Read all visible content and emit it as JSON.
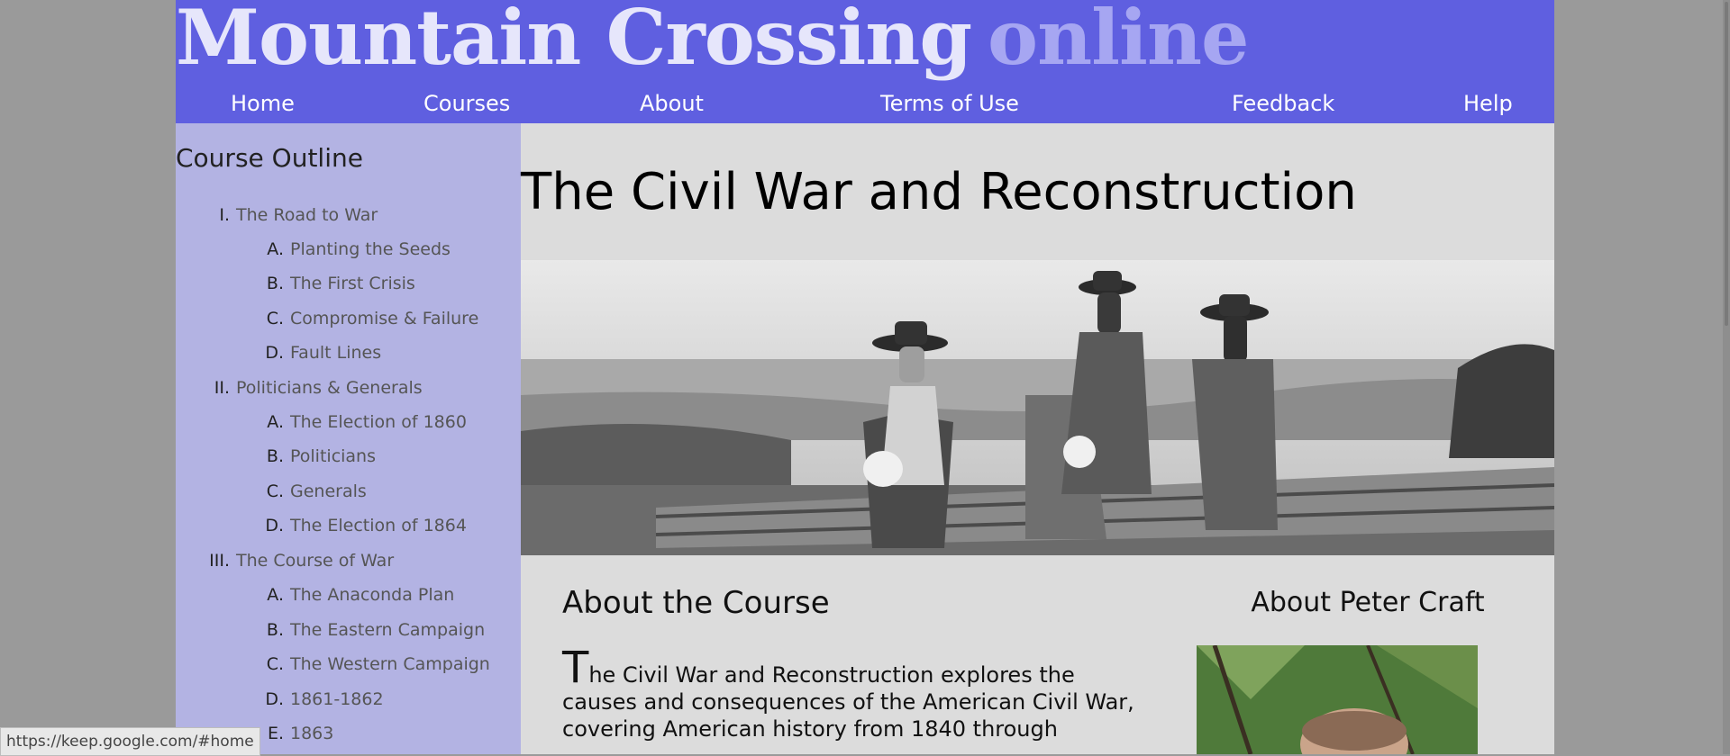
{
  "header": {
    "logo_main": "Mountain Crossing",
    "logo_sub": "online",
    "nav": [
      "Home",
      "Courses",
      "About",
      "Terms of Use",
      "Feedback",
      "Help"
    ]
  },
  "sidebar": {
    "title": "Course Outline",
    "outline": [
      {
        "num": "I.",
        "label": "The Road to War",
        "level": 1
      },
      {
        "num": "A.",
        "label": "Planting the Seeds",
        "level": 2
      },
      {
        "num": "B.",
        "label": "The First Crisis",
        "level": 2
      },
      {
        "num": "C.",
        "label": "Compromise & Failure",
        "level": 2
      },
      {
        "num": "D.",
        "label": "Fault Lines",
        "level": 2
      },
      {
        "num": "II.",
        "label": "Politicians & Generals",
        "level": 1
      },
      {
        "num": "A.",
        "label": "The Election of 1860",
        "level": 2
      },
      {
        "num": "B.",
        "label": "Politicians",
        "level": 2
      },
      {
        "num": "C.",
        "label": "Generals",
        "level": 2
      },
      {
        "num": "D.",
        "label": "The Election of 1864",
        "level": 2
      },
      {
        "num": "III.",
        "label": "The Course of War",
        "level": 1
      },
      {
        "num": "A.",
        "label": "The Anaconda Plan",
        "level": 2
      },
      {
        "num": "B.",
        "label": "The Eastern Campaign",
        "level": 2
      },
      {
        "num": "C.",
        "label": "The Western Campaign",
        "level": 2
      },
      {
        "num": "D.",
        "label": "1861-1862",
        "level": 2
      },
      {
        "num": "E.",
        "label": "1863",
        "level": 2
      }
    ]
  },
  "main": {
    "title": "The Civil War and Reconstruction",
    "about_course_heading": "About the Course",
    "about_dropcap": "T",
    "about_text": "he Civil War and Reconstruction explores the causes and consequences of the American Civil War, covering American history from 1840 through",
    "about_peter_heading": "About Peter Craft"
  },
  "status_url": "https://keep.google.com/#home",
  "colors": {
    "header_bg": "#5f5fe0",
    "sidebar_bg": "#b3b3e3",
    "content_bg": "#dcdcdc",
    "page_bg": "#9a9a9a"
  }
}
